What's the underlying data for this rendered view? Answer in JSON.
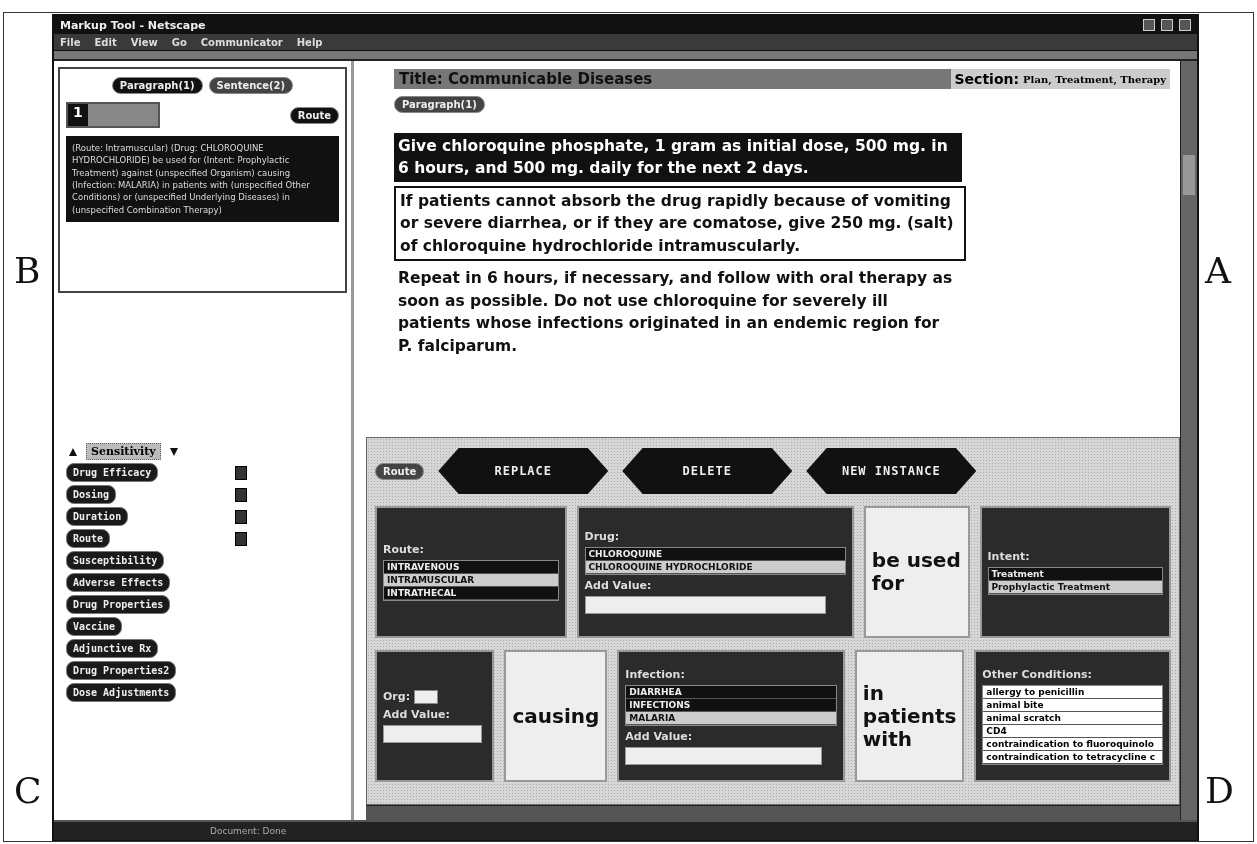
{
  "window": {
    "title": "Markup Tool - Netscape"
  },
  "menu": [
    "File",
    "Edit",
    "View",
    "Go",
    "Communicator",
    "Help"
  ],
  "left_panel": {
    "tabs": [
      {
        "label": "Paragraph(1)",
        "selected": true
      },
      {
        "label": "Sentence(2)",
        "selected": false
      }
    ],
    "instance_number": "1",
    "concept_button": "Route",
    "summary": "(Route: Intramuscular) (Drug: CHLOROQUINE HYDROCHLORIDE) be used for (Intent: Prophylactic Treatment) against (unspecified Organism) causing (Infection: MALARIA) in patients with (unspecified Other Conditions) or (unspecified Underlying Diseases) in (unspecified Combination Therapy)"
  },
  "concepts": {
    "current": "Sensitivity",
    "items": [
      {
        "label": "Drug Efficacy",
        "checked": true
      },
      {
        "label": "Dosing",
        "checked": true
      },
      {
        "label": "Duration",
        "checked": true
      },
      {
        "label": "Route",
        "checked": true
      },
      {
        "label": "Susceptibility",
        "checked": false
      },
      {
        "label": "Adverse Effects",
        "checked": false
      },
      {
        "label": "Drug Properties",
        "checked": false
      },
      {
        "label": "Vaccine",
        "checked": false
      },
      {
        "label": "Adjunctive Rx",
        "checked": false
      },
      {
        "label": "Drug Properties2",
        "checked": false
      },
      {
        "label": "Dose Adjustments",
        "checked": false
      }
    ]
  },
  "document": {
    "title": "Title: Communicable Diseases",
    "section_label": "Section:",
    "section": "Plan, Treatment, Therapy",
    "paragraph_button": "Paragraph(1)",
    "sentences": [
      {
        "kind": "highlighted",
        "text": "Give chloroquine phosphate, 1 gram as initial dose, 500 mg. in 6 hours, and 500 mg. daily for the next 2 days."
      },
      {
        "kind": "boxed",
        "text": "If patients cannot absorb the drug rapidly because of vomiting or severe diarrhea, or if they are comatose, give 250 mg. (salt) of chloroquine hydrochloride intramuscularly."
      },
      {
        "kind": "plain",
        "text": "Repeat in 6 hours, if necessary, and follow with oral therapy as soon as possible. Do not use chloroquine for severely ill patients whose infections originated in an endemic region for P. falciparum."
      }
    ]
  },
  "editor": {
    "concept_button": "Route",
    "actions": [
      "REPLACE",
      "DELETE",
      "NEW INSTANCE"
    ],
    "frame_rows": [
      {
        "frames": [
          {
            "kind": "list",
            "label": "Route:",
            "options": [
              {
                "text": "INTRAVENOUS",
                "selected": false
              },
              {
                "text": "INTRAMUSCULAR",
                "selected": true
              },
              {
                "text": "INTRATHECAL",
                "selected": false
              }
            ]
          },
          {
            "kind": "list",
            "label": "Drug:",
            "options": [
              {
                "text": "CHLOROQUINE",
                "selected": false
              },
              {
                "text": "CHLOROQUINE HYDROCHLORIDE",
                "selected": true
              }
            ],
            "add_value": "Add Value:"
          },
          {
            "kind": "text",
            "text": "be used for"
          },
          {
            "kind": "list",
            "label": "Intent:",
            "options": [
              {
                "text": "Treatment",
                "selected": false
              },
              {
                "text": "Prophylactic Treatment",
                "selected": true
              }
            ]
          }
        ]
      },
      {
        "frames": [
          {
            "kind": "org",
            "label": "Org:",
            "add_value": "Add Value:"
          },
          {
            "kind": "text",
            "text": "causing"
          },
          {
            "kind": "list",
            "label": "Infection:",
            "options": [
              {
                "text": "DIARRHEA",
                "selected": false
              },
              {
                "text": "INFECTIONS",
                "selected": false
              },
              {
                "text": "MALARIA",
                "selected": true
              }
            ],
            "add_value": "Add Value:"
          },
          {
            "kind": "text",
            "text": "in patients with"
          },
          {
            "kind": "white-list",
            "label": "Other Conditions:",
            "options": [
              {
                "text": "allergy to penicillin"
              },
              {
                "text": "animal bite"
              },
              {
                "text": "animal scratch"
              },
              {
                "text": "CD4"
              },
              {
                "text": "contraindication to fluoroquinolo"
              },
              {
                "text": "contraindication to tetracycline c"
              }
            ]
          }
        ]
      }
    ]
  },
  "status_bar": {
    "text": "Document: Done"
  },
  "annotations": [
    "B",
    "A",
    "C",
    "D"
  ]
}
